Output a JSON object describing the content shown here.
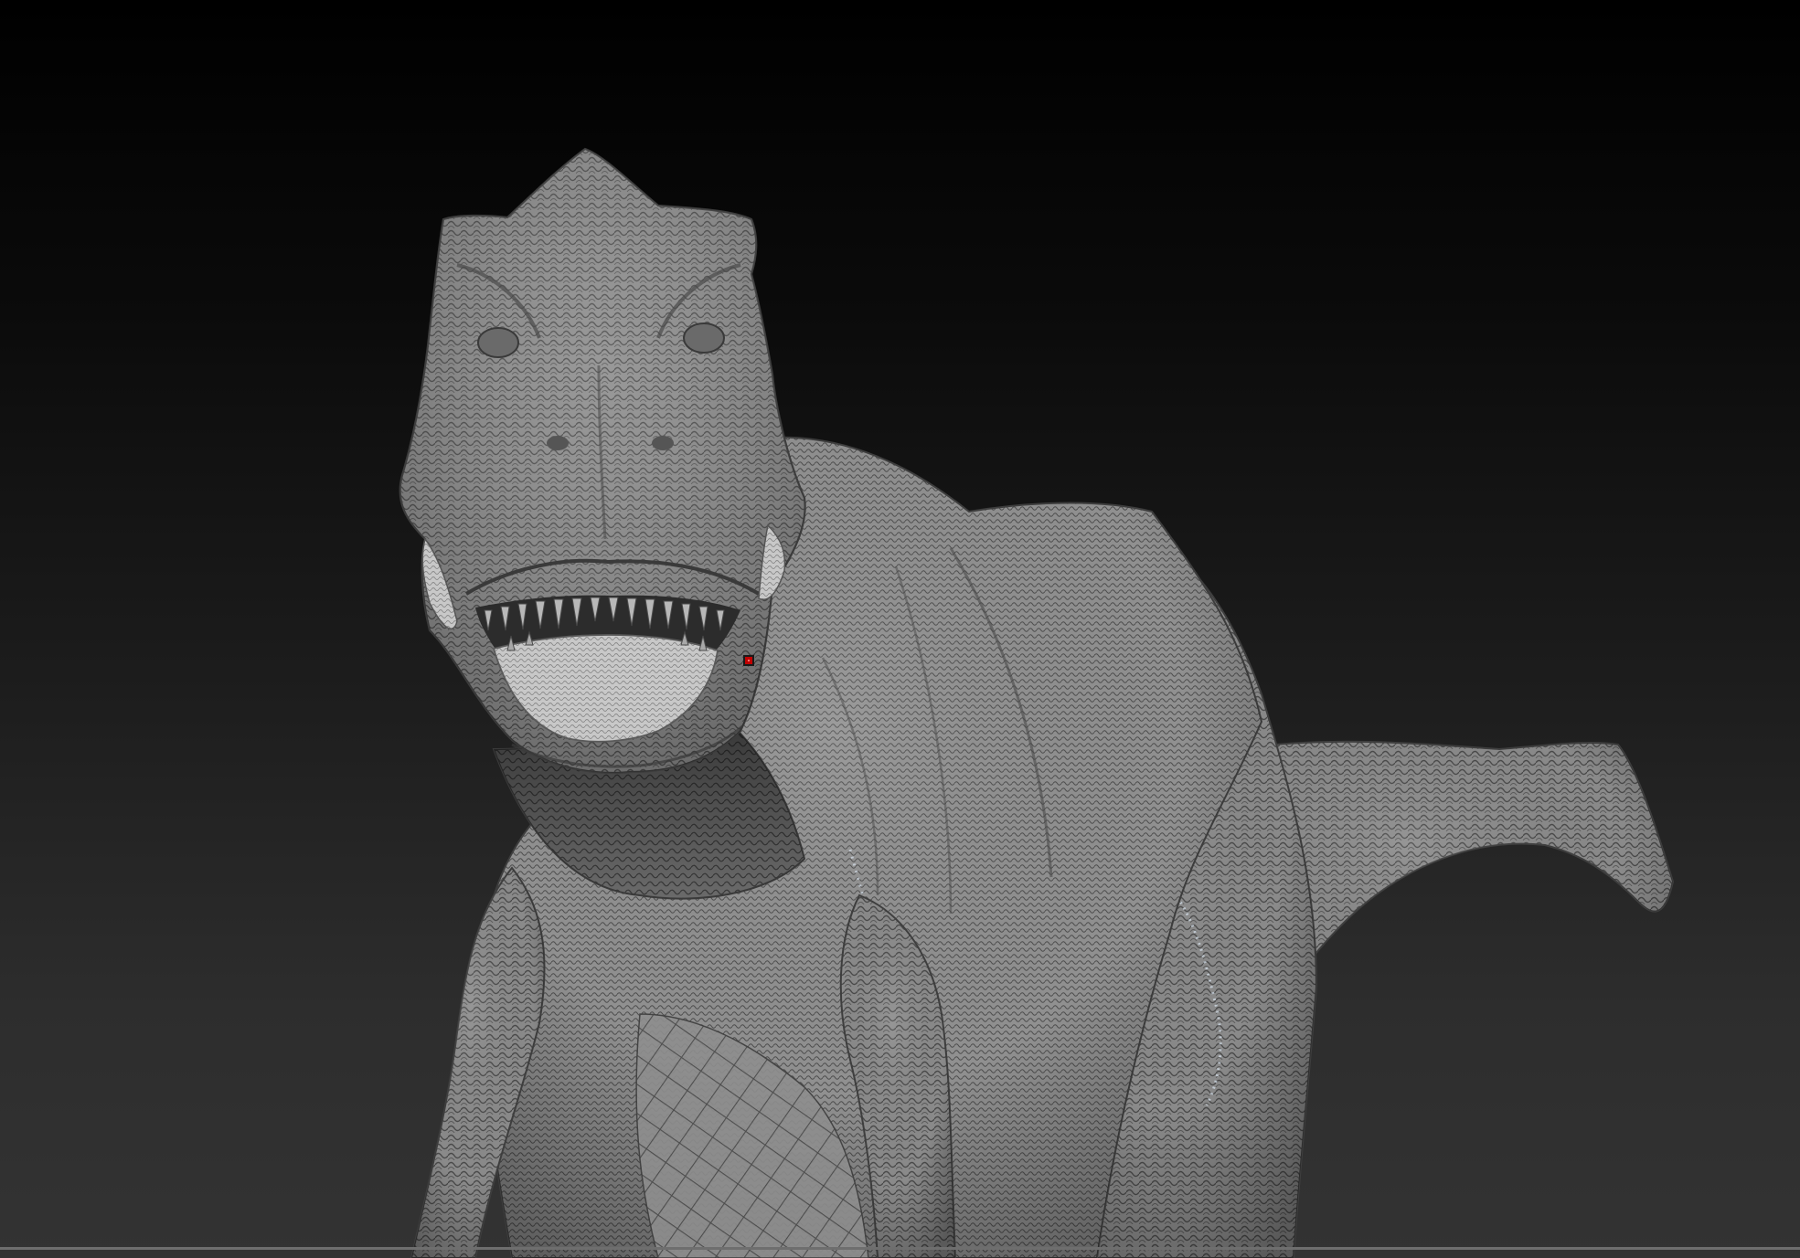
{
  "viewport": {
    "background_top": "#000000",
    "background_bottom": "#333333"
  },
  "model": {
    "subject": "t-rex-sculpt",
    "skin_base": "#8c8c8c",
    "skin_dark": "#5e5e5e",
    "skin_light": "#b4b4b4",
    "jaw_highlight": "#d2d2d2",
    "scale_line": "#3c3c3c"
  },
  "cursor": {
    "icon": "brush-cursor-icon",
    "color": "#c00000"
  }
}
